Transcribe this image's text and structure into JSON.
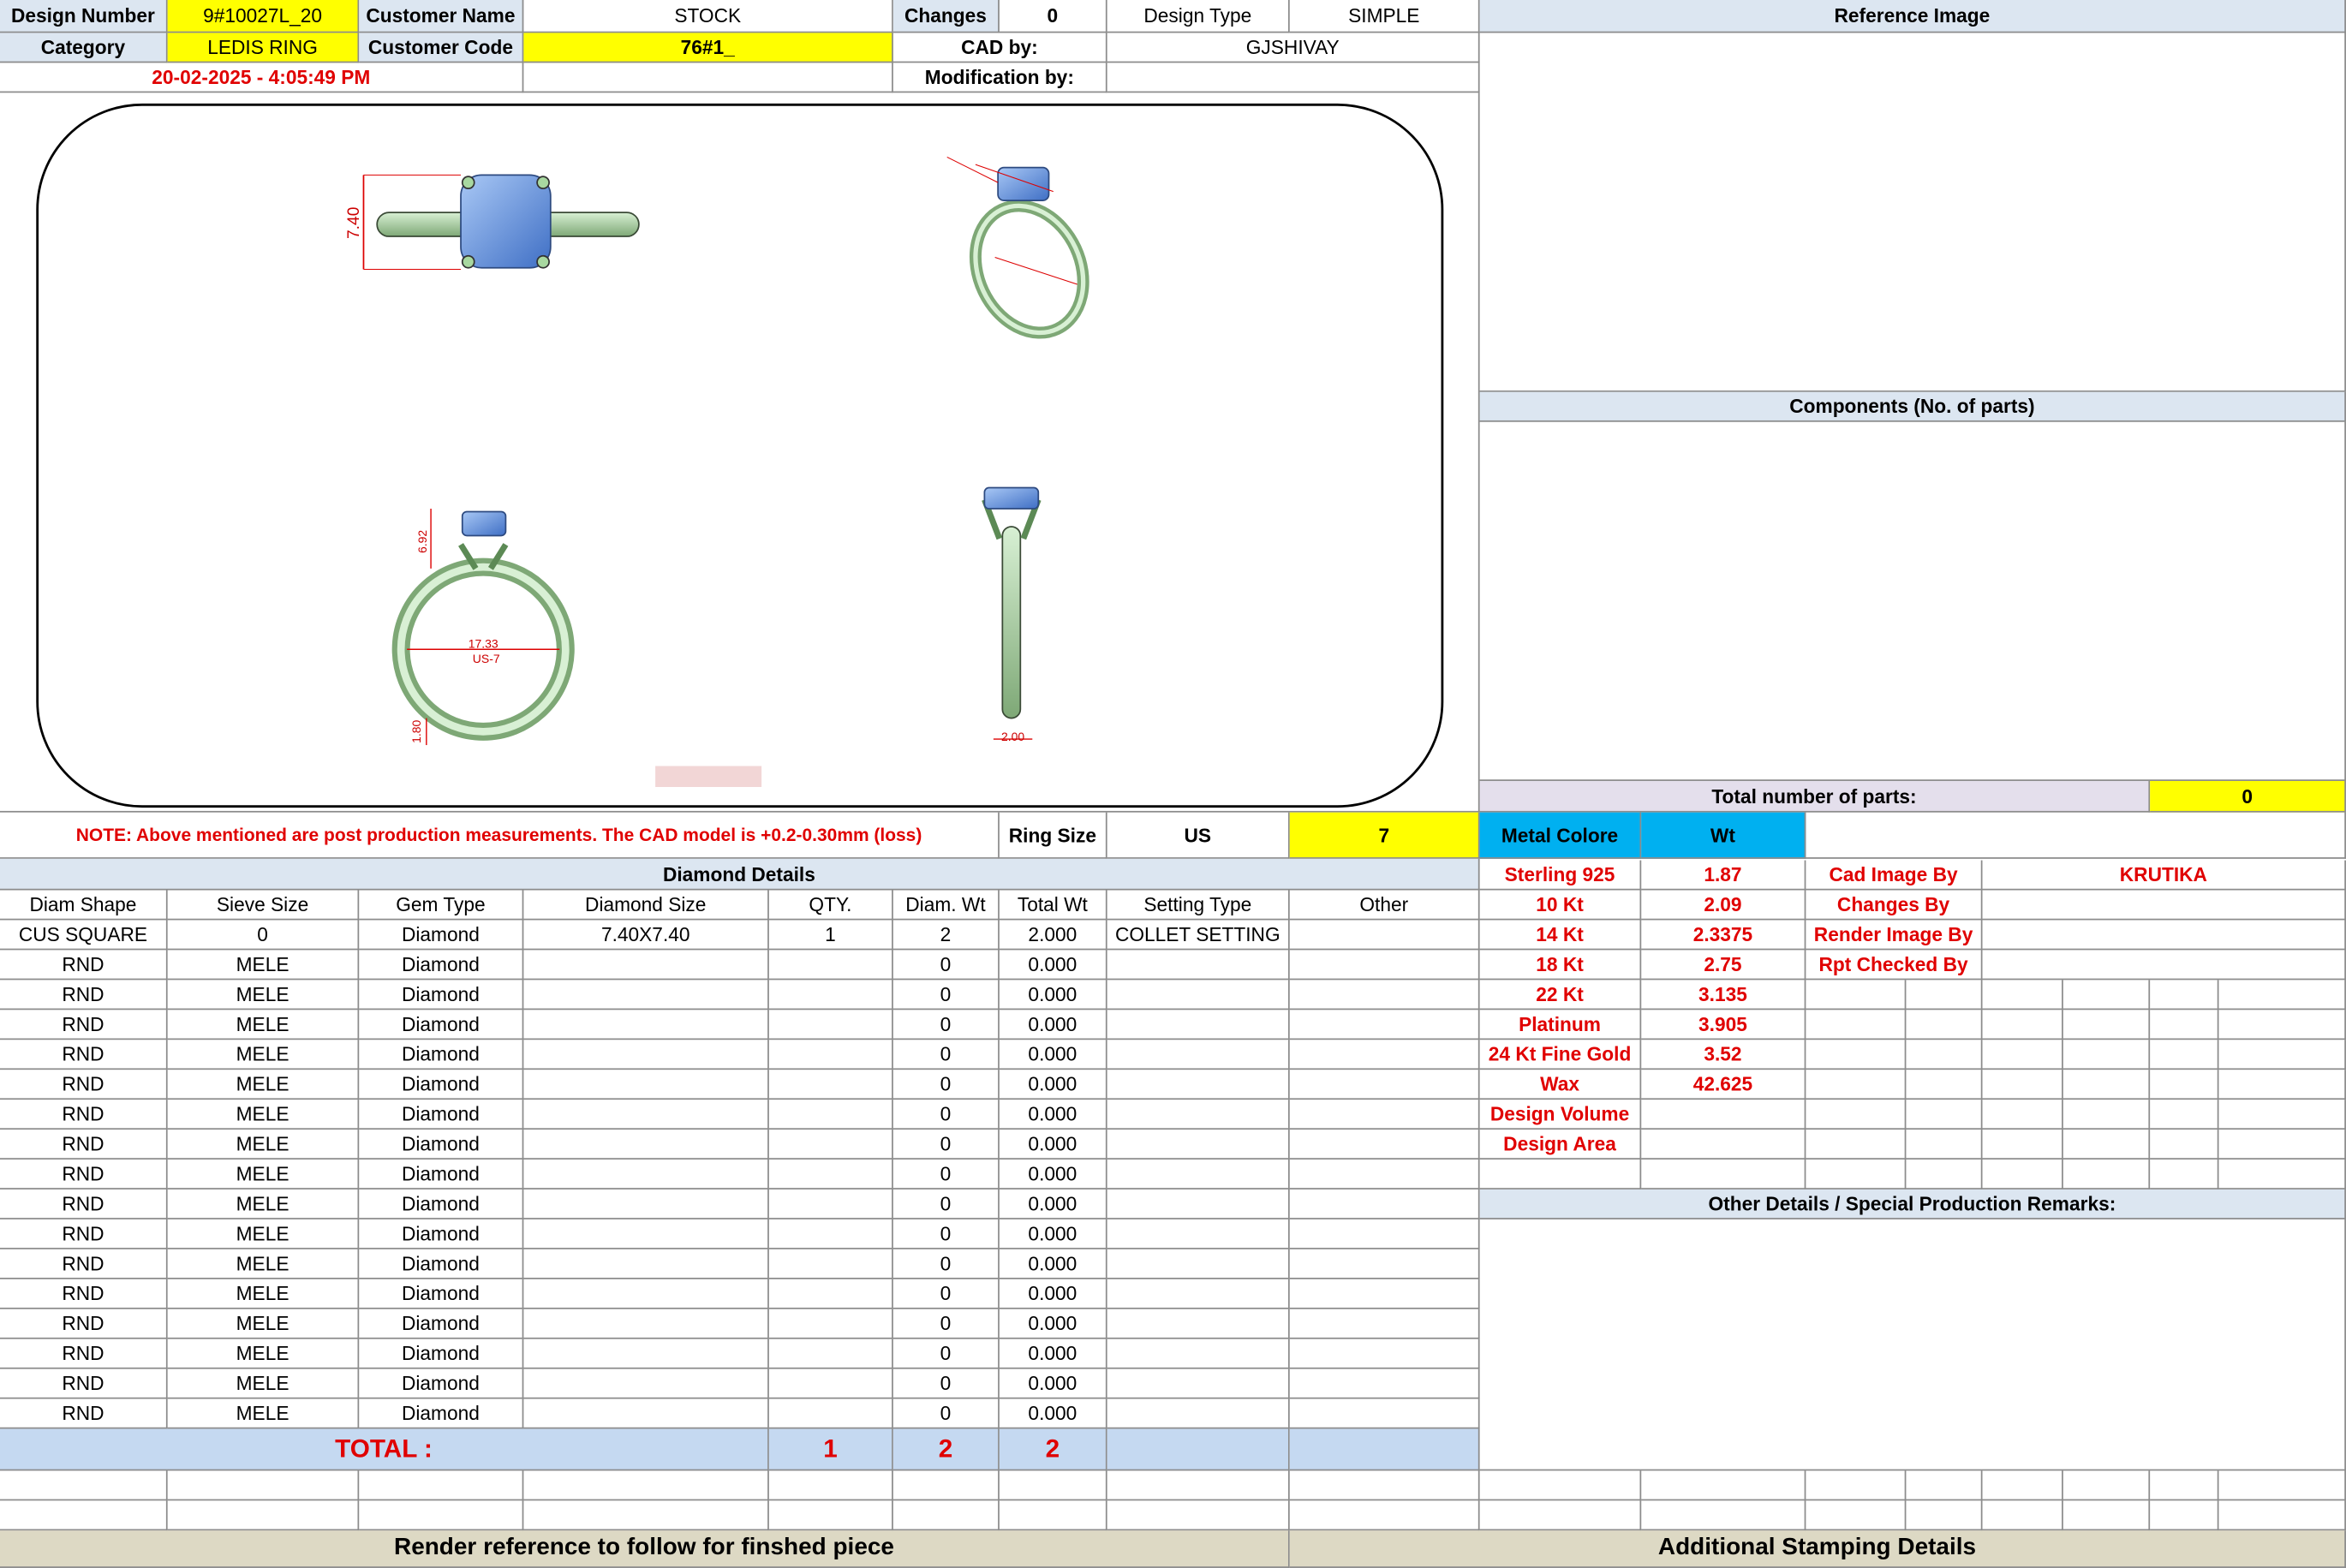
{
  "header": {
    "design_number_label": "Design Number",
    "design_number": "9#10027L_20",
    "customer_name_label": "Customer Name",
    "customer_name": "STOCK",
    "changes_label": "Changes",
    "changes": "0",
    "design_type_label": "Design Type",
    "design_type": "SIMPLE",
    "reference_image_label": "Reference Image",
    "category_label": "Category",
    "category": "LEDIS RING",
    "customer_code_label": "Customer Code",
    "customer_code": "76#1_",
    "cad_by_label": "CAD by:",
    "cad_by": "GJSHIVAY",
    "datetime": "20-02-2025 - 4:05:49 PM",
    "modification_by_label": "Modification by:"
  },
  "drawings": {
    "top_width": "7.40",
    "head_height": "6.92",
    "inner_dia": "17.33",
    "ring_us": "US-7",
    "band_thk": "1.80",
    "band_width": "2.00"
  },
  "note": "NOTE: Above mentioned are post production measurements. The CAD model is +0.2-0.30mm (loss)",
  "ring_size": {
    "label": "Ring Size",
    "unit": "US",
    "value": "7"
  },
  "components_label": "Components (No. of parts)",
  "total_parts": {
    "label": "Total number of parts:",
    "value": "0"
  },
  "diamond": {
    "title": "Diamond Details",
    "headers": [
      "Diam Shape",
      "Sieve Size",
      "Gem Type",
      "Diamond Size",
      "QTY.",
      "Diam. Wt",
      "Total Wt",
      "Setting Type",
      "Other"
    ],
    "rows": [
      [
        "CUS SQUARE",
        "0",
        "Diamond",
        "7.40X7.40",
        "1",
        "2",
        "2.000",
        "COLLET SETTING",
        ""
      ],
      [
        "RND",
        "MELE",
        "Diamond",
        "",
        "",
        "0",
        "0.000",
        "",
        ""
      ],
      [
        "RND",
        "MELE",
        "Diamond",
        "",
        "",
        "0",
        "0.000",
        "",
        ""
      ],
      [
        "RND",
        "MELE",
        "Diamond",
        "",
        "",
        "0",
        "0.000",
        "",
        ""
      ],
      [
        "RND",
        "MELE",
        "Diamond",
        "",
        "",
        "0",
        "0.000",
        "",
        ""
      ],
      [
        "RND",
        "MELE",
        "Diamond",
        "",
        "",
        "0",
        "0.000",
        "",
        ""
      ],
      [
        "RND",
        "MELE",
        "Diamond",
        "",
        "",
        "0",
        "0.000",
        "",
        ""
      ],
      [
        "RND",
        "MELE",
        "Diamond",
        "",
        "",
        "0",
        "0.000",
        "",
        ""
      ],
      [
        "RND",
        "MELE",
        "Diamond",
        "",
        "",
        "0",
        "0.000",
        "",
        ""
      ],
      [
        "RND",
        "MELE",
        "Diamond",
        "",
        "",
        "0",
        "0.000",
        "",
        ""
      ],
      [
        "RND",
        "MELE",
        "Diamond",
        "",
        "",
        "0",
        "0.000",
        "",
        ""
      ],
      [
        "RND",
        "MELE",
        "Diamond",
        "",
        "",
        "0",
        "0.000",
        "",
        ""
      ],
      [
        "RND",
        "MELE",
        "Diamond",
        "",
        "",
        "0",
        "0.000",
        "",
        ""
      ],
      [
        "RND",
        "MELE",
        "Diamond",
        "",
        "",
        "0",
        "0.000",
        "",
        ""
      ],
      [
        "RND",
        "MELE",
        "Diamond",
        "",
        "",
        "0",
        "0.000",
        "",
        ""
      ],
      [
        "RND",
        "MELE",
        "Diamond",
        "",
        "",
        "0",
        "0.000",
        "",
        ""
      ],
      [
        "RND",
        "MELE",
        "Diamond",
        "",
        "",
        "0",
        "0.000",
        "",
        ""
      ]
    ],
    "total_label": "TOTAL :",
    "total_qty": "1",
    "total_diam_wt": "2",
    "total_wt": "2"
  },
  "metal": {
    "color_label": "Metal Colore",
    "wt_label": "Wt",
    "rows": [
      [
        "Sterling 925",
        "1.87"
      ],
      [
        "10 Kt",
        "2.09"
      ],
      [
        "14 Kt",
        "2.3375"
      ],
      [
        "18 Kt",
        "2.75"
      ],
      [
        "22 Kt",
        "3.135"
      ],
      [
        "Platinum",
        "3.905"
      ],
      [
        "24 Kt Fine Gold",
        "3.52"
      ],
      [
        "Wax",
        "42.625"
      ],
      [
        "Design Volume",
        ""
      ],
      [
        "Design Area",
        ""
      ]
    ]
  },
  "credits": [
    [
      "Cad Image By",
      "KRUTIKA"
    ],
    [
      "Changes By",
      ""
    ],
    [
      "Render Image By",
      ""
    ],
    [
      "Rpt Checked By",
      ""
    ]
  ],
  "other_details_label": "Other Details / Special Production Remarks:",
  "footer": {
    "render_label": "Render reference to follow for finshed piece",
    "stamping_label": "Additional Stamping Details"
  }
}
